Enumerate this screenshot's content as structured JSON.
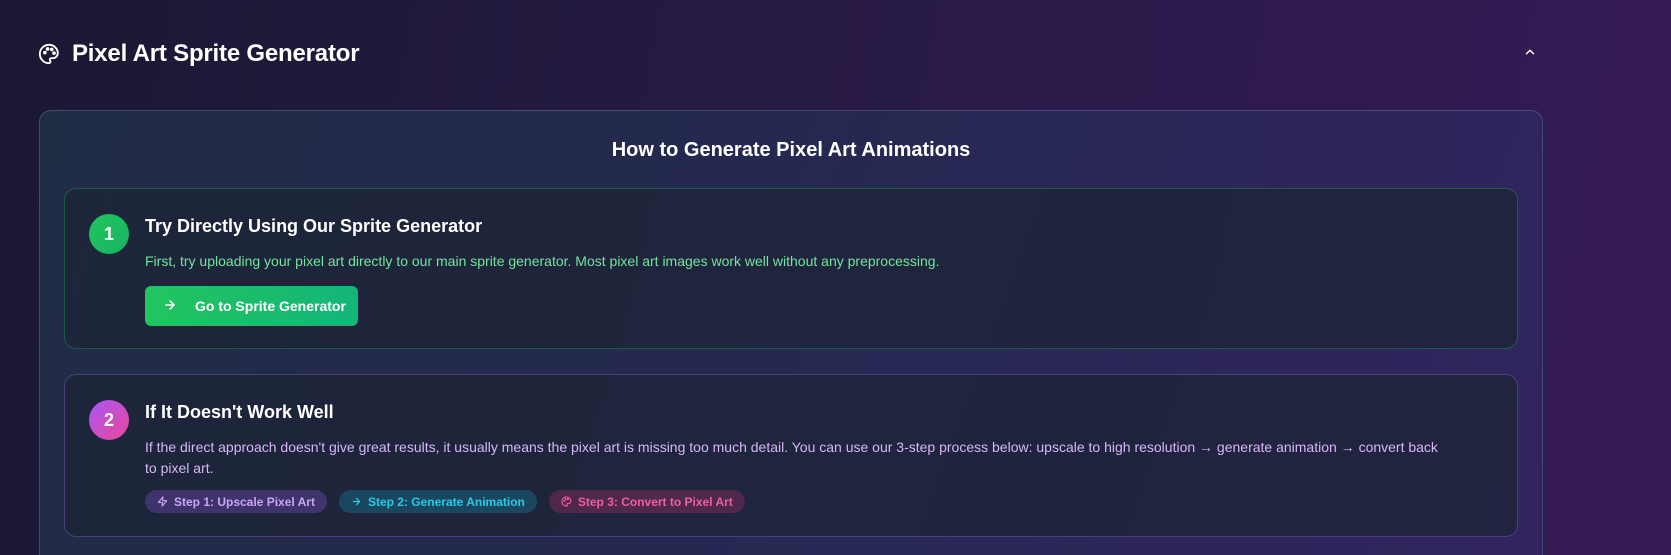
{
  "header": {
    "title": "Pixel Art Sprite Generator",
    "icon": "palette-icon",
    "collapse_icon": "chevron-up-icon"
  },
  "panel": {
    "title": "How to Generate Pixel Art Animations",
    "steps": [
      {
        "number": "1",
        "title": "Try Directly Using Our Sprite Generator",
        "description": "First, try uploading your pixel art directly to our main sprite generator. Most pixel art images work well without any preprocessing.",
        "button_label": "Go to Sprite Generator",
        "button_icon": "arrow-right-icon"
      },
      {
        "number": "2",
        "title": "If It Doesn't Work Well",
        "description": "If the direct approach doesn't give great results, it usually means the pixel art is missing too much detail. You can use our 3-step process below: upscale to high resolution → generate animation → convert back to pixel art.",
        "chips": [
          {
            "label": "Step 1: Upscale Pixel Art",
            "icon": "zap-icon"
          },
          {
            "label": "Step 2: Generate Animation",
            "icon": "arrow-right-icon"
          },
          {
            "label": "Step 3: Convert to Pixel Art",
            "icon": "palette-icon"
          }
        ]
      }
    ]
  },
  "colors": {
    "accent_green": "#22c55e",
    "accent_purple": "#a855f7",
    "accent_pink": "#ec4899",
    "accent_cyan": "#2cc9e6"
  }
}
